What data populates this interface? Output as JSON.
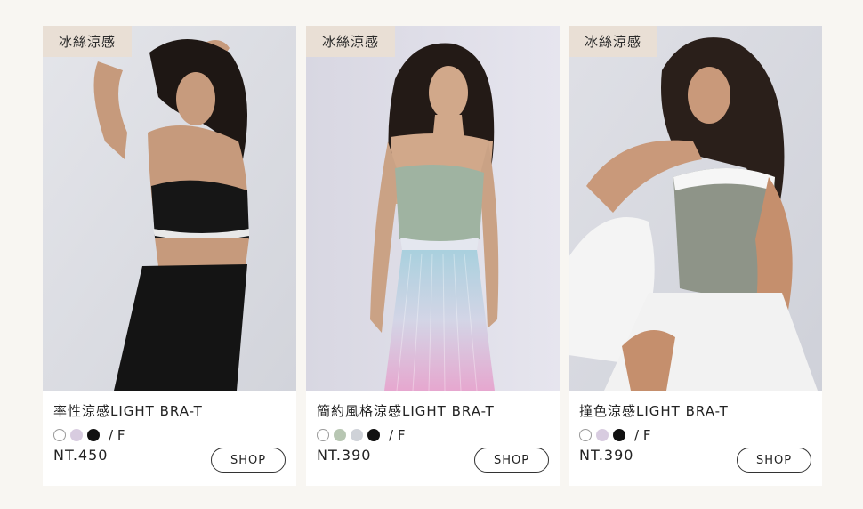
{
  "products": [
    {
      "badge": "冰絲涼感",
      "title": "率性涼感LIGHT BRA-T",
      "swatches": [
        "white",
        "lavender",
        "black"
      ],
      "swatch_colors": [
        "#ffffff",
        "#d8cce0",
        "#111111"
      ],
      "size": "/ F",
      "price": "NT.450",
      "shop_label": "SHOP"
    },
    {
      "badge": "冰絲涼感",
      "title": "簡約風格涼感LIGHT BRA-T",
      "swatches": [
        "white",
        "sage",
        "light-gray",
        "black"
      ],
      "swatch_colors": [
        "#ffffff",
        "#b7c6b2",
        "#cfd2d8",
        "#111111"
      ],
      "size": "/ F",
      "price": "NT.390",
      "shop_label": "SHOP"
    },
    {
      "badge": "冰絲涼感",
      "title": "撞色涼感LIGHT BRA-T",
      "swatches": [
        "white",
        "lavender",
        "black"
      ],
      "swatch_colors": [
        "#ffffff",
        "#d8cce0",
        "#111111"
      ],
      "size": "/ F",
      "price": "NT.390",
      "shop_label": "SHOP"
    }
  ]
}
